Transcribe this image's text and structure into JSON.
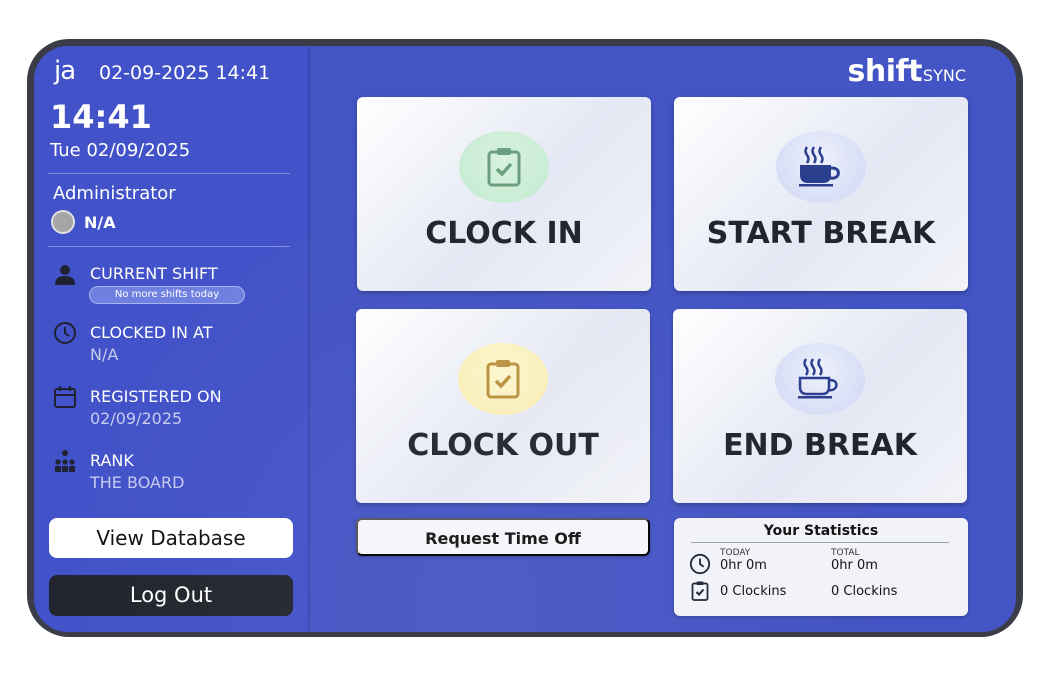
{
  "sidebar": {
    "brand": "ja",
    "top_datetime": "02-09-2025 14:41",
    "time": "14:41",
    "date": "Tue 02/09/2025",
    "role": "Administrator",
    "status": "N/A",
    "current_shift": {
      "label": "CURRENT SHIFT",
      "badge": "No more shifts today"
    },
    "clocked_in_at": {
      "label": "CLOCKED IN AT",
      "value": "N/A"
    },
    "registered_on": {
      "label": "REGISTERED ON",
      "value": "02/09/2025"
    },
    "rank": {
      "label": "RANK",
      "value": "THE BOARD"
    },
    "view_database": "View Database",
    "log_out": "Log Out"
  },
  "logo": {
    "main": "shift",
    "sub": "SYNC"
  },
  "actions": {
    "clock_in": "CLOCK IN",
    "start_break": "START BREAK",
    "clock_out": "CLOCK OUT",
    "end_break": "END BREAK",
    "request_time_off": "Request Time Off"
  },
  "stats": {
    "title": "Your Statistics",
    "today_caption": "TODAY",
    "total_caption": "TOTAL",
    "today_hours": "0hr 0m",
    "total_hours": "0hr 0m",
    "today_clockins": "0 Clockins",
    "total_clockins": "0 Clockins"
  },
  "colors": {
    "screen": "#4354c4",
    "bezel": "#3a3d47",
    "clock_in_accent": "#6b9f7d",
    "clock_out_accent": "#b9923f",
    "break_accent": "#2c3f8f"
  }
}
